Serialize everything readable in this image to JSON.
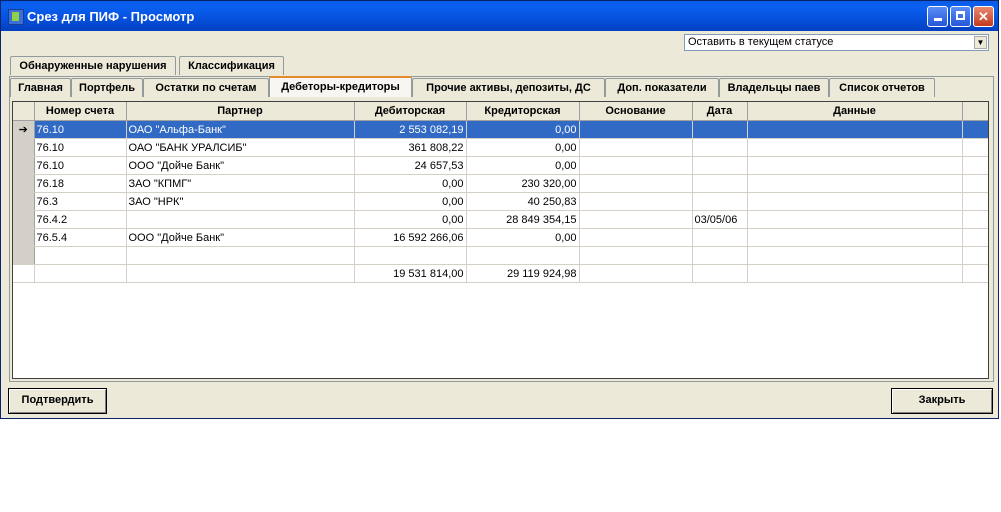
{
  "window": {
    "title": "Срез для ПИФ - Просмотр"
  },
  "status_select": {
    "value": "Оставить в текущем статусе"
  },
  "top_tabs": [
    "Обнаруженные нарушения",
    "Классификация"
  ],
  "tabs": [
    "Главная",
    "Портфель",
    "Остатки по счетам",
    "Дебеторы-кредиторы",
    "Прочие активы, депозиты, ДС",
    "Доп. показатели",
    "Владельцы паев",
    "Список отчетов"
  ],
  "table": {
    "columns": [
      "",
      "Номер счета",
      "Партнер",
      "Дебиторская",
      "Кредиторская",
      "Основание",
      "Дата",
      "Данные",
      ""
    ],
    "rows": [
      {
        "marker": "➔",
        "account": "76.10",
        "partner": "ОАО \"Альфа-Банк\"",
        "debit": "2 553 082,19",
        "credit": "0,00",
        "basis": "",
        "date": "",
        "data": ""
      },
      {
        "marker": "",
        "account": "76.10",
        "partner": "ОАО \"БАНК УРАЛСИБ\"",
        "debit": "361 808,22",
        "credit": "0,00",
        "basis": "",
        "date": "",
        "data": ""
      },
      {
        "marker": "",
        "account": "76.10",
        "partner": "ООО \"Дойче Банк\"",
        "debit": "24 657,53",
        "credit": "0,00",
        "basis": "",
        "date": "",
        "data": ""
      },
      {
        "marker": "",
        "account": "76.18",
        "partner": "ЗАО \"КПМГ\"",
        "debit": "0,00",
        "credit": "230 320,00",
        "basis": "",
        "date": "",
        "data": ""
      },
      {
        "marker": "",
        "account": "76.3",
        "partner": "ЗАО \"НРК\"",
        "debit": "0,00",
        "credit": "40 250,83",
        "basis": "",
        "date": "",
        "data": ""
      },
      {
        "marker": "",
        "account": "76.4.2",
        "partner": "",
        "debit": "0,00",
        "credit": "28 849 354,15",
        "basis": "",
        "date": "03/05/06",
        "data": ""
      },
      {
        "marker": "",
        "account": "76.5.4",
        "partner": "ООО \"Дойче Банк\"",
        "debit": "16 592 266,06",
        "credit": "0,00",
        "basis": "",
        "date": "",
        "data": ""
      },
      {
        "marker": "",
        "account": "",
        "partner": "",
        "debit": "",
        "credit": "",
        "basis": "",
        "date": "",
        "data": ""
      }
    ],
    "totals": {
      "debit": "19 531 814,00",
      "credit": "29 119 924,98"
    }
  },
  "buttons": {
    "confirm": "Подтвердить",
    "close": "Закрыть"
  }
}
